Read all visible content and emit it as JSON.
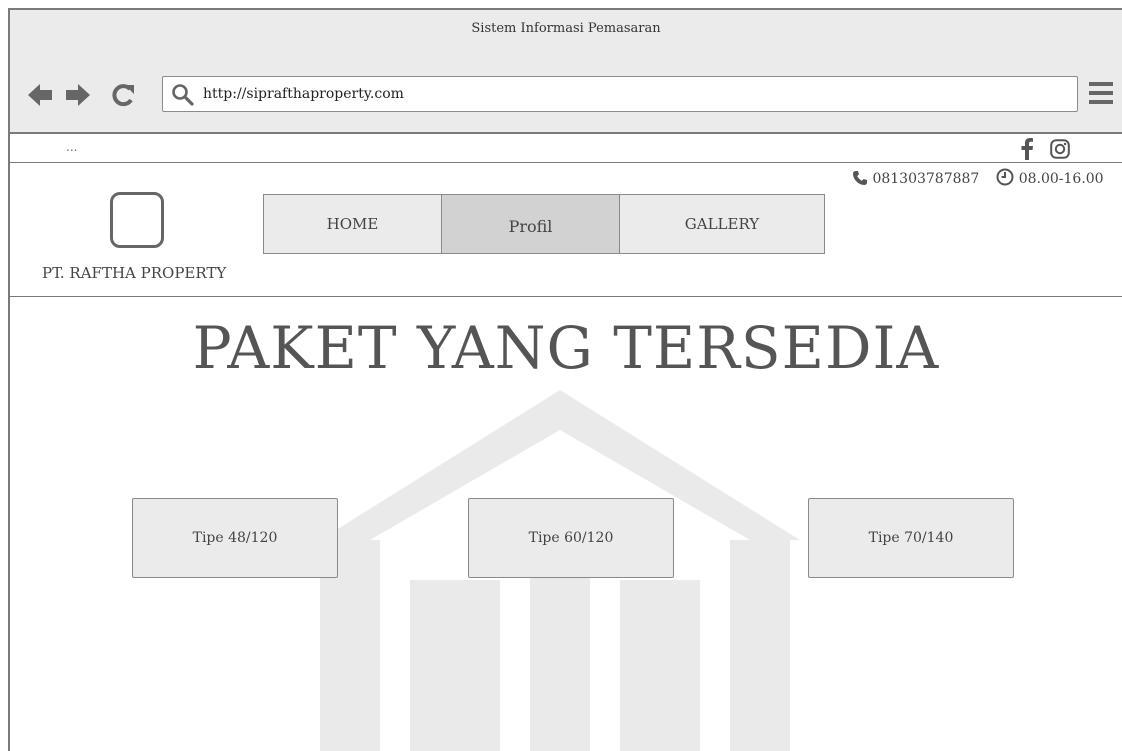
{
  "window": {
    "title": "Sistem Informasi Pemasaran"
  },
  "browser": {
    "url": "http://siprafthaproperty.com",
    "back_icon": "back-arrow-icon",
    "forward_icon": "forward-arrow-icon",
    "reload_icon": "reload-icon",
    "menu_icon": "hamburger-menu-icon"
  },
  "topbar": {
    "placeholder_text": "...",
    "social": [
      "facebook-icon",
      "instagram-icon"
    ]
  },
  "contact": {
    "phone": "081303787887",
    "hours": "08.00-16.00"
  },
  "brand": {
    "company_name": "PT. RAFTHA PROPERTY"
  },
  "nav": {
    "items": [
      {
        "label": "HOME"
      },
      {
        "label": "Profil",
        "active": true
      },
      {
        "label": "GALLERY"
      }
    ]
  },
  "main": {
    "heading": "PAKET YANG TERSEDIA",
    "packages": [
      {
        "label": "Tipe 48/120"
      },
      {
        "label": "Tipe 60/120"
      },
      {
        "label": "Tipe 70/140"
      }
    ]
  },
  "colors": {
    "chrome_bg": "#ebebeb",
    "border": "#7a7a7a",
    "active_nav": "#d2d2d2",
    "text": "#444444"
  }
}
